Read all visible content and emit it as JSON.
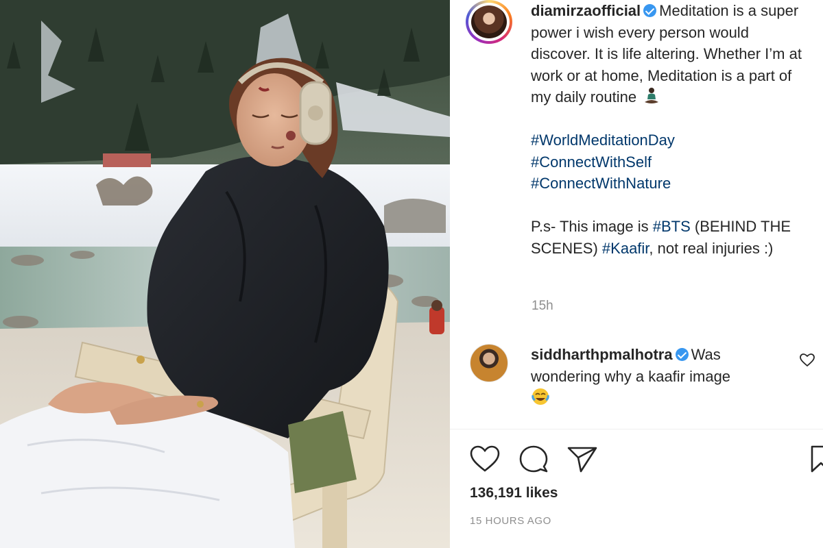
{
  "post": {
    "username": "diamirzaofficial",
    "caption_text": "Meditation is a super power i wish every person would discover. It is life altering. Whether I’m at work or at home, Meditation is a part of my daily routine",
    "caption_emoji": "person-in-lotus-position-emoji",
    "hashtags": [
      "#WorldMeditationDay",
      "#ConnectWithSelf",
      "#ConnectWithNature"
    ],
    "ps_prefix": "P.s- This image is",
    "ps_tag_1": "#BTS",
    "ps_middle": "(BEHIND THE SCENES)",
    "ps_tag_2": "#Kaafir",
    "ps_suffix": ", not real injuries :)",
    "time_ago": "15h"
  },
  "comment": {
    "username": "siddharthpmalhotra",
    "text": "Was wondering why a kaafir image",
    "emoji": "face-with-tears-of-joy-emoji"
  },
  "actions": {
    "like_icon": "heart-icon",
    "comment_icon": "comment-bubble-icon",
    "share_icon": "paper-plane-icon",
    "save_icon": "bookmark-icon"
  },
  "likes_count": "136,191 likes",
  "timestamp": "15 HOURS AGO",
  "colors": {
    "hashtag": "#00376b",
    "verified": "#3897f0",
    "muted_text": "#8e8e8e",
    "text": "#262626"
  }
}
